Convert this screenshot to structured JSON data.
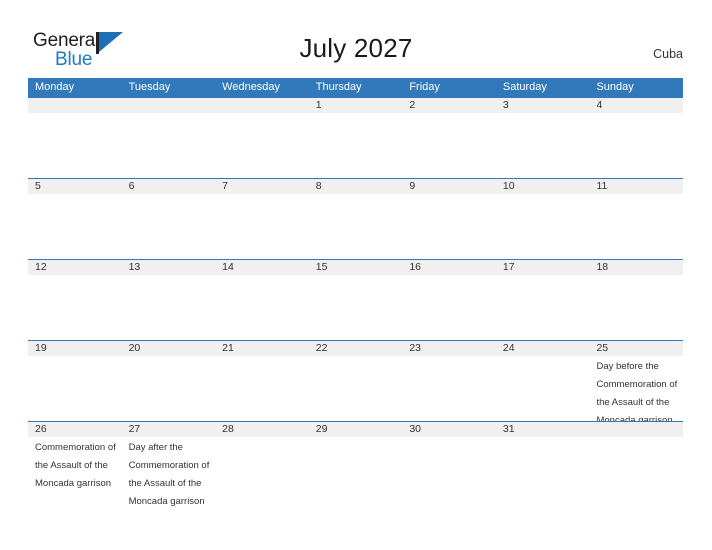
{
  "brand": {
    "name_top": "General",
    "name_bottom": "Blue",
    "accent_color": "#1f7ac4",
    "triangle_color": "#1f6fb5"
  },
  "header": {
    "title": "July 2027",
    "country": "Cuba",
    "header_bg": "#3279bc",
    "band_bg": "#f0f0f0"
  },
  "weekdays": [
    "Monday",
    "Tuesday",
    "Wednesday",
    "Thursday",
    "Friday",
    "Saturday",
    "Sunday"
  ],
  "weeks": [
    [
      {
        "day": "",
        "event": ""
      },
      {
        "day": "",
        "event": ""
      },
      {
        "day": "",
        "event": ""
      },
      {
        "day": "1",
        "event": ""
      },
      {
        "day": "2",
        "event": ""
      },
      {
        "day": "3",
        "event": ""
      },
      {
        "day": "4",
        "event": ""
      }
    ],
    [
      {
        "day": "5",
        "event": ""
      },
      {
        "day": "6",
        "event": ""
      },
      {
        "day": "7",
        "event": ""
      },
      {
        "day": "8",
        "event": ""
      },
      {
        "day": "9",
        "event": ""
      },
      {
        "day": "10",
        "event": ""
      },
      {
        "day": "11",
        "event": ""
      }
    ],
    [
      {
        "day": "12",
        "event": ""
      },
      {
        "day": "13",
        "event": ""
      },
      {
        "day": "14",
        "event": ""
      },
      {
        "day": "15",
        "event": ""
      },
      {
        "day": "16",
        "event": ""
      },
      {
        "day": "17",
        "event": ""
      },
      {
        "day": "18",
        "event": ""
      }
    ],
    [
      {
        "day": "19",
        "event": ""
      },
      {
        "day": "20",
        "event": ""
      },
      {
        "day": "21",
        "event": ""
      },
      {
        "day": "22",
        "event": ""
      },
      {
        "day": "23",
        "event": ""
      },
      {
        "day": "24",
        "event": ""
      },
      {
        "day": "25",
        "event": "Day before the Commemoration of the Assault of the Moncada garrison"
      }
    ],
    [
      {
        "day": "26",
        "event": "Commemoration of the Assault of the Moncada garrison"
      },
      {
        "day": "27",
        "event": "Day after the Commemoration of the Assault of the Moncada garrison"
      },
      {
        "day": "28",
        "event": ""
      },
      {
        "day": "29",
        "event": ""
      },
      {
        "day": "30",
        "event": ""
      },
      {
        "day": "31",
        "event": ""
      },
      {
        "day": "",
        "event": ""
      }
    ]
  ]
}
